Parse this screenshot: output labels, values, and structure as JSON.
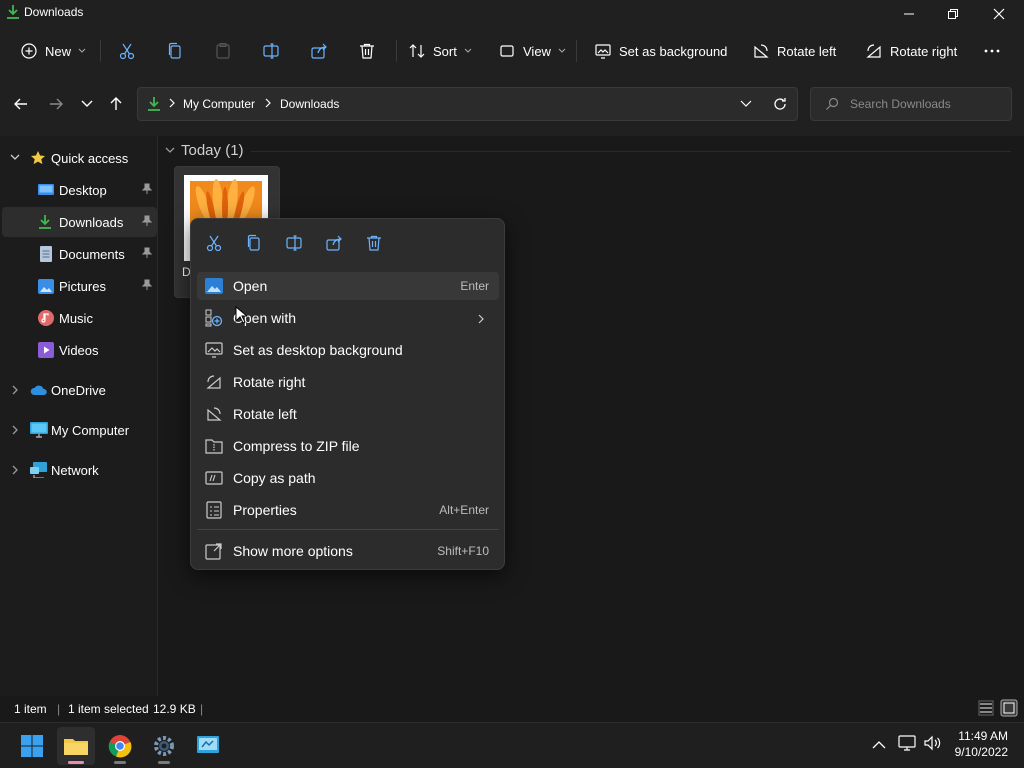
{
  "window": {
    "title": "Downloads"
  },
  "toolbar": {
    "new_label": "New",
    "sort_label": "Sort",
    "view_label": "View",
    "set_bg_label": "Set as background",
    "rotate_left_label": "Rotate left",
    "rotate_right_label": "Rotate right"
  },
  "address": {
    "segments": [
      "My Computer",
      "Downloads"
    ],
    "search_placeholder": "Search Downloads"
  },
  "sidebar": {
    "quick_access": "Quick access",
    "items": [
      {
        "label": "Desktop",
        "icon": "desktop-icon",
        "pinned": true
      },
      {
        "label": "Downloads",
        "icon": "download-icon",
        "pinned": true
      },
      {
        "label": "Documents",
        "icon": "documents-icon",
        "pinned": true
      },
      {
        "label": "Pictures",
        "icon": "pictures-icon",
        "pinned": true
      },
      {
        "label": "Music",
        "icon": "music-icon",
        "pinned": false
      },
      {
        "label": "Videos",
        "icon": "videos-icon",
        "pinned": false
      }
    ],
    "roots": [
      {
        "label": "OneDrive",
        "icon": "onedrive-icon"
      },
      {
        "label": "My Computer",
        "icon": "computer-icon"
      },
      {
        "label": "Network",
        "icon": "network-icon"
      }
    ]
  },
  "content": {
    "group_header": "Today (1)",
    "file": {
      "name_visible": "D"
    }
  },
  "context_menu": {
    "items": [
      {
        "label": "Open",
        "shortcut": "Enter"
      },
      {
        "label": "Open with",
        "shortcut": ""
      },
      {
        "label": "Set as desktop background",
        "shortcut": ""
      },
      {
        "label": "Rotate right",
        "shortcut": ""
      },
      {
        "label": "Rotate left",
        "shortcut": ""
      },
      {
        "label": "Compress to ZIP file",
        "shortcut": ""
      },
      {
        "label": "Copy as path",
        "shortcut": ""
      },
      {
        "label": "Properties",
        "shortcut": "Alt+Enter"
      },
      {
        "label": "Show more options",
        "shortcut": "Shift+F10"
      }
    ]
  },
  "status": {
    "item_count": "1 item",
    "selected": "1 item selected",
    "size": "12.9 KB"
  },
  "taskbar": {
    "time": "11:49 AM",
    "date": "9/10/2022"
  },
  "colors": {
    "accent_green": "#3fb950",
    "folder_yellow": "#f3c844",
    "window_bg": "#191919",
    "menu_bg": "#2c2c2c"
  }
}
